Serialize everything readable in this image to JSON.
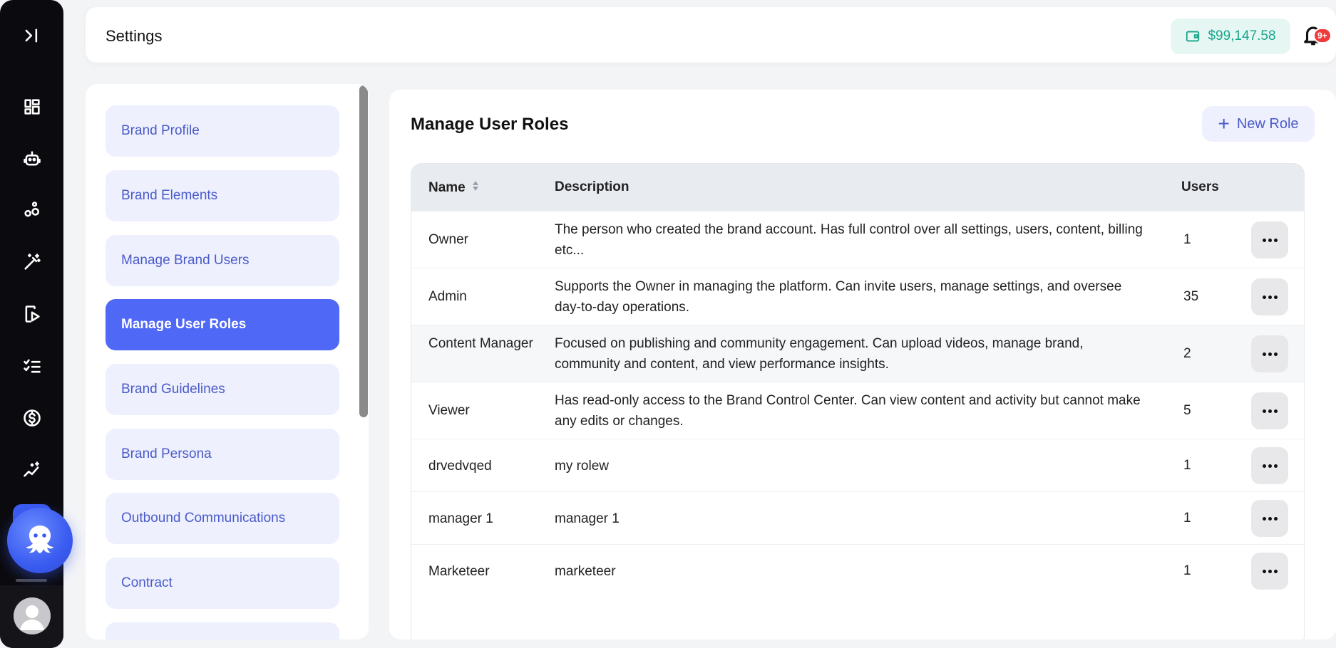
{
  "rail": {
    "items": [
      {
        "name": "expand-sidebar-icon"
      },
      {
        "name": "dashboard-icon"
      },
      {
        "name": "robot-icon"
      },
      {
        "name": "bubbles-icon"
      },
      {
        "name": "magic-wand-icon"
      },
      {
        "name": "video-play-icon"
      },
      {
        "name": "checklist-icon"
      },
      {
        "name": "dollar-icon"
      },
      {
        "name": "sparkle-chart-icon"
      }
    ]
  },
  "header": {
    "title": "Settings",
    "wallet_balance": "$99,147.58",
    "notification_badge": "9+"
  },
  "subnav": {
    "items": [
      {
        "label": "Brand Profile",
        "active": false
      },
      {
        "label": "Brand Elements",
        "active": false
      },
      {
        "label": "Manage Brand Users",
        "active": false
      },
      {
        "label": "Manage User Roles",
        "active": true
      },
      {
        "label": "Brand Guidelines",
        "active": false
      },
      {
        "label": "Brand Persona",
        "active": false
      },
      {
        "label": "Outbound Communications",
        "active": false
      },
      {
        "label": "Contract",
        "active": false
      },
      {
        "label": "",
        "active": false
      }
    ]
  },
  "main": {
    "title": "Manage User Roles",
    "new_role_label": "New Role",
    "table": {
      "columns": {
        "name": "Name",
        "description": "Description",
        "users": "Users"
      },
      "rows": [
        {
          "name": "Owner",
          "description": "The person who created the brand account. Has full control over all settings, users, content, billing etc...",
          "users": "1"
        },
        {
          "name": "Admin",
          "description": "Supports the Owner in managing the platform. Can invite users, manage settings, and oversee day-to-day operations.",
          "users": "35"
        },
        {
          "name": "Content Manager",
          "description": "Focused on publishing and community engagement. Can upload videos, manage brand, community and content, and view performance insights.",
          "users": "2"
        },
        {
          "name": "Viewer",
          "description": "Has read-only access to the Brand Control Center. Can view content and activity but cannot make any edits or changes.",
          "users": "5"
        },
        {
          "name": "drvedvqed",
          "description": "my rolew",
          "users": "1"
        },
        {
          "name": "manager 1",
          "description": "manager 1",
          "users": "1"
        },
        {
          "name": "Marketeer",
          "description": "marketeer",
          "users": "1"
        }
      ]
    }
  },
  "colors": {
    "accent": "#4f68f6",
    "accent_soft": "#eef0fe",
    "wallet_text": "#17a58a",
    "badge": "#ef3b3b",
    "rail_bg": "#0b0b0f"
  }
}
